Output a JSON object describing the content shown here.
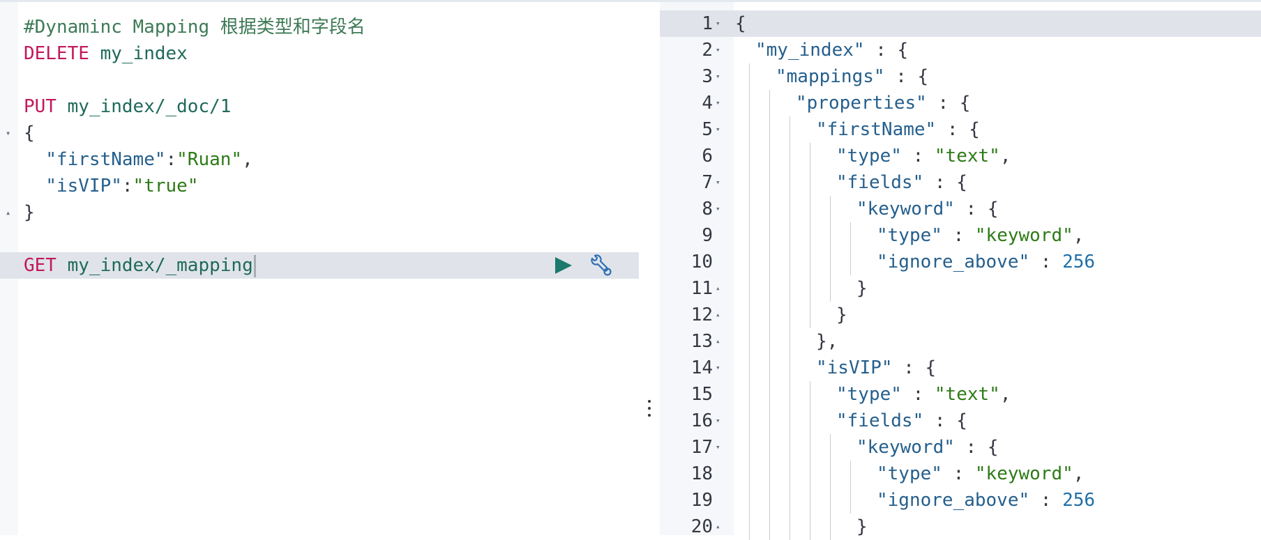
{
  "request": {
    "lines": [
      {
        "fold": "",
        "tokens": [
          {
            "t": "#Dynaminc Mapping 根据类型和字段名",
            "c": "comment"
          }
        ]
      },
      {
        "fold": "",
        "tokens": [
          {
            "t": "DELETE",
            "c": "method"
          },
          {
            "t": " my_index",
            "c": "path"
          }
        ]
      },
      {
        "fold": "",
        "tokens": []
      },
      {
        "fold": "",
        "tokens": [
          {
            "t": "PUT",
            "c": "method"
          },
          {
            "t": " my_index/_doc/1",
            "c": "path"
          }
        ]
      },
      {
        "fold": "open",
        "tokens": [
          {
            "t": "{",
            "c": "punct"
          }
        ]
      },
      {
        "fold": "",
        "tokens": [
          {
            "t": "  ",
            "c": "punct"
          },
          {
            "t": "\"firstName\"",
            "c": "key"
          },
          {
            "t": ":",
            "c": "punct"
          },
          {
            "t": "\"Ruan\"",
            "c": "str"
          },
          {
            "t": ",",
            "c": "punct"
          }
        ]
      },
      {
        "fold": "",
        "tokens": [
          {
            "t": "  ",
            "c": "punct"
          },
          {
            "t": "\"isVIP\"",
            "c": "key"
          },
          {
            "t": ":",
            "c": "punct"
          },
          {
            "t": "\"true\"",
            "c": "str"
          }
        ]
      },
      {
        "fold": "close",
        "tokens": [
          {
            "t": "}",
            "c": "punct"
          }
        ]
      },
      {
        "fold": "",
        "tokens": []
      },
      {
        "fold": "",
        "active": true,
        "cursor": true,
        "tokens": [
          {
            "t": "GET",
            "c": "method"
          },
          {
            "t": " my_index/_mapping",
            "c": "path"
          }
        ]
      }
    ]
  },
  "response": {
    "lines": [
      {
        "num": "1",
        "fold": "open",
        "depth": 0,
        "active": true,
        "tokens": [
          {
            "t": "{",
            "c": "punct"
          }
        ]
      },
      {
        "num": "2",
        "fold": "open",
        "depth": 1,
        "tokens": [
          {
            "t": "\"my_index\"",
            "c": "key"
          },
          {
            "t": " : {",
            "c": "punct"
          }
        ]
      },
      {
        "num": "3",
        "fold": "open",
        "depth": 2,
        "tokens": [
          {
            "t": "\"mappings\"",
            "c": "key"
          },
          {
            "t": " : {",
            "c": "punct"
          }
        ]
      },
      {
        "num": "4",
        "fold": "open",
        "depth": 3,
        "tokens": [
          {
            "t": "\"properties\"",
            "c": "key"
          },
          {
            "t": " : {",
            "c": "punct"
          }
        ]
      },
      {
        "num": "5",
        "fold": "open",
        "depth": 4,
        "tokens": [
          {
            "t": "\"firstName\"",
            "c": "key"
          },
          {
            "t": " : {",
            "c": "punct"
          }
        ]
      },
      {
        "num": "6",
        "fold": "",
        "depth": 5,
        "tokens": [
          {
            "t": "\"type\"",
            "c": "key"
          },
          {
            "t": " : ",
            "c": "punct"
          },
          {
            "t": "\"text\"",
            "c": "str"
          },
          {
            "t": ",",
            "c": "punct"
          }
        ]
      },
      {
        "num": "7",
        "fold": "open",
        "depth": 5,
        "tokens": [
          {
            "t": "\"fields\"",
            "c": "key"
          },
          {
            "t": " : {",
            "c": "punct"
          }
        ]
      },
      {
        "num": "8",
        "fold": "open",
        "depth": 6,
        "tokens": [
          {
            "t": "\"keyword\"",
            "c": "key"
          },
          {
            "t": " : {",
            "c": "punct"
          }
        ]
      },
      {
        "num": "9",
        "fold": "",
        "depth": 7,
        "tokens": [
          {
            "t": "\"type\"",
            "c": "key"
          },
          {
            "t": " : ",
            "c": "punct"
          },
          {
            "t": "\"keyword\"",
            "c": "str"
          },
          {
            "t": ",",
            "c": "punct"
          }
        ]
      },
      {
        "num": "10",
        "fold": "",
        "depth": 7,
        "tokens": [
          {
            "t": "\"ignore_above\"",
            "c": "key"
          },
          {
            "t": " : ",
            "c": "punct"
          },
          {
            "t": "256",
            "c": "num"
          }
        ]
      },
      {
        "num": "11",
        "fold": "close",
        "depth": 6,
        "tokens": [
          {
            "t": "}",
            "c": "punct"
          }
        ]
      },
      {
        "num": "12",
        "fold": "close",
        "depth": 5,
        "tokens": [
          {
            "t": "}",
            "c": "punct"
          }
        ]
      },
      {
        "num": "13",
        "fold": "close",
        "depth": 4,
        "tokens": [
          {
            "t": "},",
            "c": "punct"
          }
        ]
      },
      {
        "num": "14",
        "fold": "open",
        "depth": 4,
        "tokens": [
          {
            "t": "\"isVIP\"",
            "c": "key"
          },
          {
            "t": " : {",
            "c": "punct"
          }
        ]
      },
      {
        "num": "15",
        "fold": "",
        "depth": 5,
        "tokens": [
          {
            "t": "\"type\"",
            "c": "key"
          },
          {
            "t": " : ",
            "c": "punct"
          },
          {
            "t": "\"text\"",
            "c": "str"
          },
          {
            "t": ",",
            "c": "punct"
          }
        ]
      },
      {
        "num": "16",
        "fold": "open",
        "depth": 5,
        "tokens": [
          {
            "t": "\"fields\"",
            "c": "key"
          },
          {
            "t": " : {",
            "c": "punct"
          }
        ]
      },
      {
        "num": "17",
        "fold": "open",
        "depth": 6,
        "tokens": [
          {
            "t": "\"keyword\"",
            "c": "key"
          },
          {
            "t": " : {",
            "c": "punct"
          }
        ]
      },
      {
        "num": "18",
        "fold": "",
        "depth": 7,
        "tokens": [
          {
            "t": "\"type\"",
            "c": "key"
          },
          {
            "t": " : ",
            "c": "punct"
          },
          {
            "t": "\"keyword\"",
            "c": "str"
          },
          {
            "t": ",",
            "c": "punct"
          }
        ]
      },
      {
        "num": "19",
        "fold": "",
        "depth": 7,
        "tokens": [
          {
            "t": "\"ignore_above\"",
            "c": "key"
          },
          {
            "t": " : ",
            "c": "punct"
          },
          {
            "t": "256",
            "c": "num"
          }
        ]
      },
      {
        "num": "20",
        "fold": "close",
        "depth": 6,
        "tokens": [
          {
            "t": "}",
            "c": "punct"
          }
        ]
      }
    ]
  },
  "icons": {
    "run": "play-icon",
    "settings": "wrench-icon",
    "resize": "vertical-dots-icon"
  },
  "colors": {
    "method": "#c2185b",
    "path": "#1f6a5a",
    "key": "#255f8c",
    "string": "#2d7a17",
    "number": "#1f6fa8",
    "comment": "#3e7a56",
    "active_line": "#e0e4ea",
    "run_button": "#1b7a6b",
    "wrench": "#2f6fb3"
  }
}
